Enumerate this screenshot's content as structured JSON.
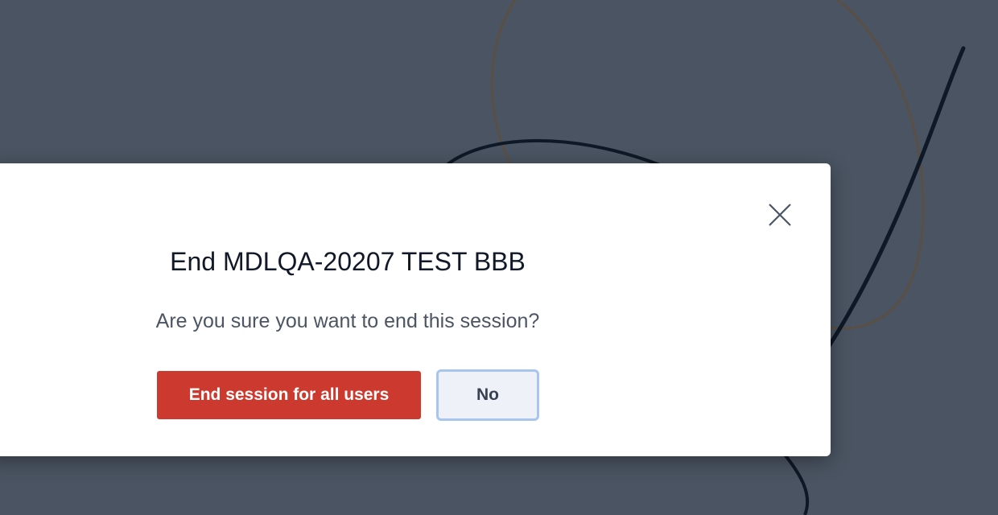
{
  "dialog": {
    "title": "End MDLQA-20207 TEST BBB",
    "message": "Are you sure you want to end this session?",
    "confirm_label": "End session for all users",
    "cancel_label": "No",
    "close_icon": "close-icon"
  },
  "colors": {
    "backdrop": "#4a5462",
    "danger": "#cc3a2f",
    "secondary_bg": "#eef2f8",
    "secondary_focus_ring": "#a8c5ee"
  }
}
